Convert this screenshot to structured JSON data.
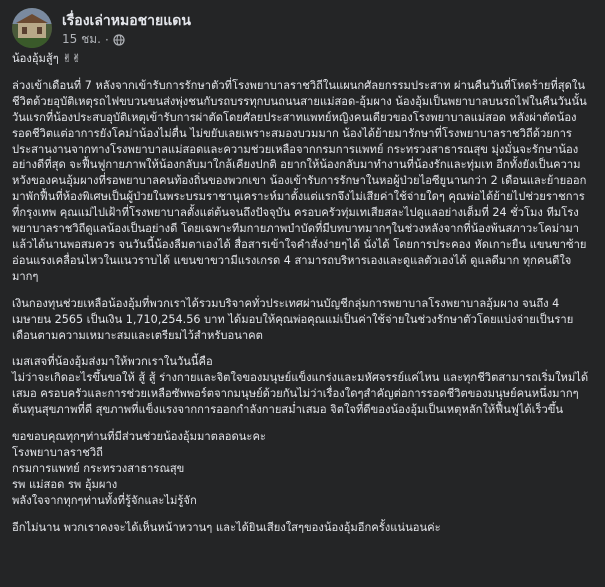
{
  "post": {
    "author": "เรื่องเล่าหมอชายแดน",
    "time": "15 ชม.",
    "dot": "·",
    "privacy_icon": "globe-icon",
    "paragraphs": [
      "น้องอุ้มสู้ๆ ✌✌",
      "ล่วงเข้าเดือนที่ 7 หลังจากเข้ารับการรักษาตัวที่โรงพยาบาลราชวิถีในแผนกศัลยกรรมประสาท ผ่านคืนวันที่โหดร้ายที่สุดในชีวิตด้วยอุบัติเหตุรถไฟขบวนขนส่งพุ่งชนกับรถบรรทุกบนถนนสายแม่สอด-อุ้มผาง น้องอุ้มเป็นพยาบาลบนรถไฟในคืนวันนั้น วันแรกที่น้องประสบอุบัติเหตุเข้ารับการผ่าตัดโดยศัลยประสาทแพทย์หญิงคนเดียวของโรงพยาบาลแม่สอด หลังผ่าตัดน้องรอดชีวิตแต่อาการยังโคม่าน้องไม่ตื่น ไม่ขยับเลยเพราะสมองบวมมาก น้องได้ย้ายมารักษาที่โรงพยาบาลราชวิถีด้วยการประสานงานจากทางโรงพยาบาลแม่สอดและความช่วยเหลือจากกรมการแพทย์ กระทรวงสาธารณสุข มุ่งมั่นจะรักษาน้องอย่างดีที่สุด จะฟื้นฟูกายภาพให้น้องกลับมาใกล้เคียงปกติ อยากให้น้องกลับมาทำงานที่น้องรักและทุ่มเท อีกทั้งยังเป็นความหวังของคนอุ้มผางที่รอพยาบาลคนท้องถิ่นของพวกเขา น้องเข้ารับการรักษาในหอผู้ป่วยไอซียูนานกว่า 2 เดือนและย้ายออกมาพักฟื้นที่ห้องพิเศษเป็นผู้ป่วยในพระบรมราชานุเคราะห์มาตั้งแต่แรกจึงไม่เสียค่าใช้จ่ายใดๆ คุณพ่อได้ย้ายไปช่วยราชการที่กรุงเทพ คุณแม่ไปเฝ้าที่โรงพยาบาลตั้งแต่ต้นจนถึงปัจจุบัน ครอบครัวทุ่มเทเสียสละไปดูแลอย่างเต็มที่ 24 ชั่วโมง ทีมโรงพยาบาลราชวิถีดูแลน้องเป็นอย่างดี โดยเฉพาะทีมกายภาพบำบัดที่มีบทบาทมากๆในช่วงหลังจากที่น้องพ้นสภาวะโคม่ามาแล้วได้นานพอสมควร จนวันนี้น้องลืมตาเองได้ สื่อสารเข้าใจคำสั่งง่ายๆได้ นั่งได้ โดยการประคอง หัดเกาะยืน แขนขาซ้ายอ่อนแรงเคลื่อนไหวในแนวราบได้ แขนขาขวามีแรงเกรด 4 สามารถบริหารเองและดูแลตัวเองได้ ดูแลดีมาก ทุกคนดีใจมากๆ",
      "เงินกองทุนช่วยเหลือน้องอุ้มที่พวกเราได้รวมบริจาคทั่วประเทศผ่านบัญชีกลุ่มการพยาบาลโรงพยาบาลอุ้มผาง จนถึง 4 เมษายน 2565 เป็นเงิน 1,710,254.56 บาท ได้มอบให้คุณพ่อคุณแม่เป็นค่าใช้จ่ายในช่วงรักษาตัวโดยแบ่งจ่ายเป็นรายเดือนตามความเหมาะสมและเตรียมไว้สำหรับอนาคต",
      "เมสเสจที่น้องอุ้มส่งมาให้พวกเราในวันนี้คือ\nไม่ว่าจะเกิดอะไรขึ้นขอให้ สู้ สู้ ร่างกายและจิตใจของมนุษย์แข็งแกร่งและมหัศจรรย์แค่ไหน และทุกชีวิตสามารถเริ่มใหม่ได้เสมอ ครอบครัวและการช่วยเหลือซัพพอร์ตจากมนุษย์ด้วยกันไม่ว่าเรื่องใดๆสำคัญต่อการรอดชีวิตของมนุษย์คนหนึ่งมากๆ ต้นทุนสุขภาพที่ดี สุขภาพที่แข็งแรงจากการออกกำลังกายสม่ำเสมอ จิตใจที่ดีของน้องอุ้มเป็นเหตุหลักให้ฟื้นฟูได้เร็วขึ้น"
    ],
    "thanks": [
      "ขอขอบคุณทุกๆท่านที่มีส่วนช่วยน้องอุ้มมาตลอดนะคะ",
      "โรงพยาบาลราชวิถี",
      "กรมการแพทย์ กระทรวงสาธารณสุข",
      "รพ แม่สอด รพ อุ้มผาง",
      "พลังใจจากทุกๆท่านทั้งที่รู้จักและไม่รู้จัก"
    ],
    "closing": "อีกไม่นาน พวกเราคงจะได้เห็นหน้าหวานๆ และได้ยินเสียงใสๆของน้องอุ้มอีกครั้งแน่นอนค่ะ"
  }
}
